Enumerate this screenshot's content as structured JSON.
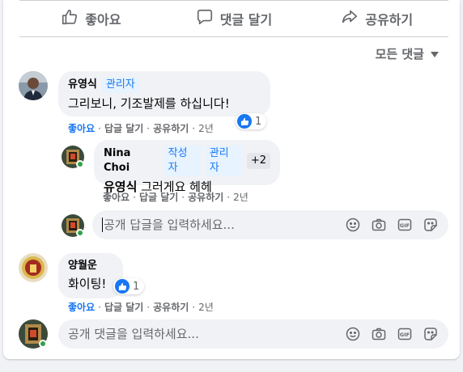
{
  "actions": {
    "like_label": "좋아요",
    "comment_label": "댓글 달기",
    "share_label": "공유하기"
  },
  "sort": {
    "label": "모든 댓글"
  },
  "comments": [
    {
      "author": "유영식",
      "badges": [
        "관리자"
      ],
      "text": "그리보니, 기조발제를 하십니다!",
      "actions": {
        "like": "좋아요",
        "reply": "답글 달기",
        "share": "공유하기",
        "time": "2년"
      },
      "reactions": "1",
      "replies": [
        {
          "author": "Nina Choi",
          "badges": [
            "작성자",
            "관리자"
          ],
          "more_badges": "+2",
          "mention": "유영식",
          "text": "그러게요 헤헤",
          "actions": {
            "like": "좋아요",
            "reply": "답글 달기",
            "share": "공유하기",
            "time": "2년"
          }
        }
      ]
    },
    {
      "author": "양월운",
      "text": "화이팅!",
      "actions": {
        "like": "좋아요",
        "reply": "답글 달기",
        "share": "공유하기",
        "time": "2년"
      },
      "reactions": "1"
    }
  ],
  "reply_input": {
    "placeholder": "공개 답글을 입력하세요..."
  },
  "comment_input": {
    "placeholder": "공개 댓글을 입력하세요..."
  },
  "colors": {
    "accent": "#1877f2",
    "secondary_text": "#65676b",
    "bubble": "#f0f2f5",
    "online": "#31a24c"
  },
  "icons": [
    "thumbs-up-icon",
    "comment-icon",
    "share-icon",
    "emoji-icon",
    "camera-icon",
    "gif-icon",
    "sticker-icon"
  ]
}
